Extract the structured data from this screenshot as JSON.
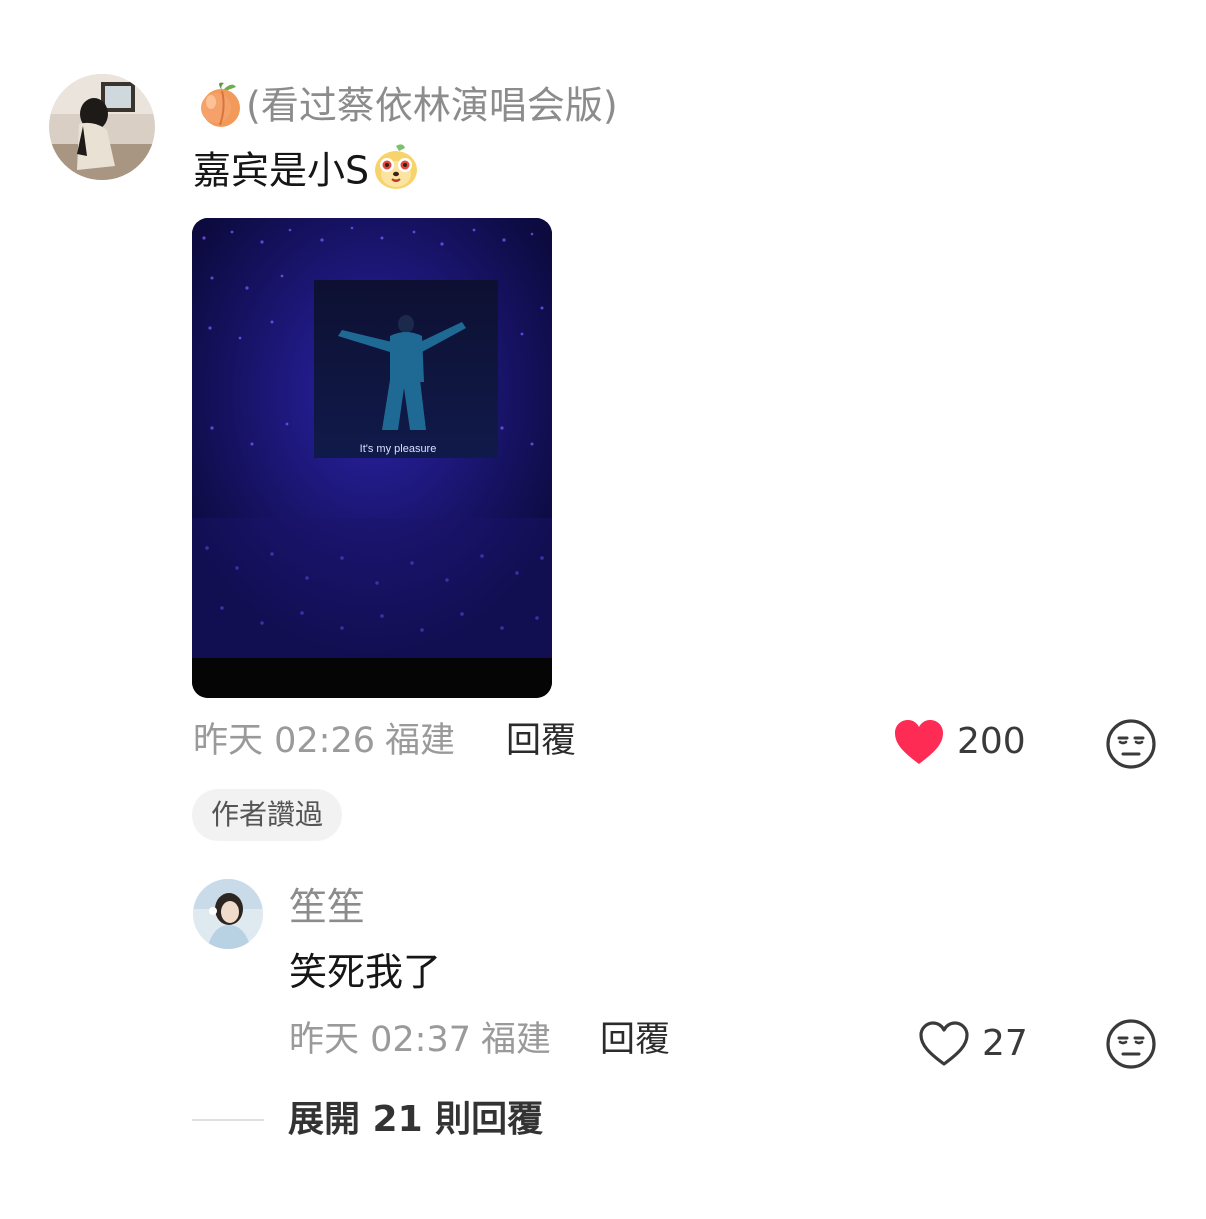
{
  "main_comment": {
    "username_emoji": "peach-emoji",
    "username": "(看过蔡依林演唱会版)",
    "text": "嘉宾是小S",
    "text_emoji": "dog-face-emoji",
    "image_caption": "It's my pleasure",
    "time": "昨天 02:26",
    "location": "福建",
    "reply_label": "回覆",
    "like_count": "200",
    "liked": true,
    "badge": "作者讚過"
  },
  "reply_comment": {
    "username": "笙笙",
    "text": "笑死我了",
    "time": "昨天 02:37",
    "location": "福建",
    "reply_label": "回覆",
    "like_count": "27",
    "liked": false
  },
  "expand_replies": {
    "label": "展開 21 則回覆"
  },
  "colors": {
    "like_red": "#fe2c55",
    "meta_gray": "#9a9a9a",
    "badge_bg": "#f2f2f2"
  }
}
